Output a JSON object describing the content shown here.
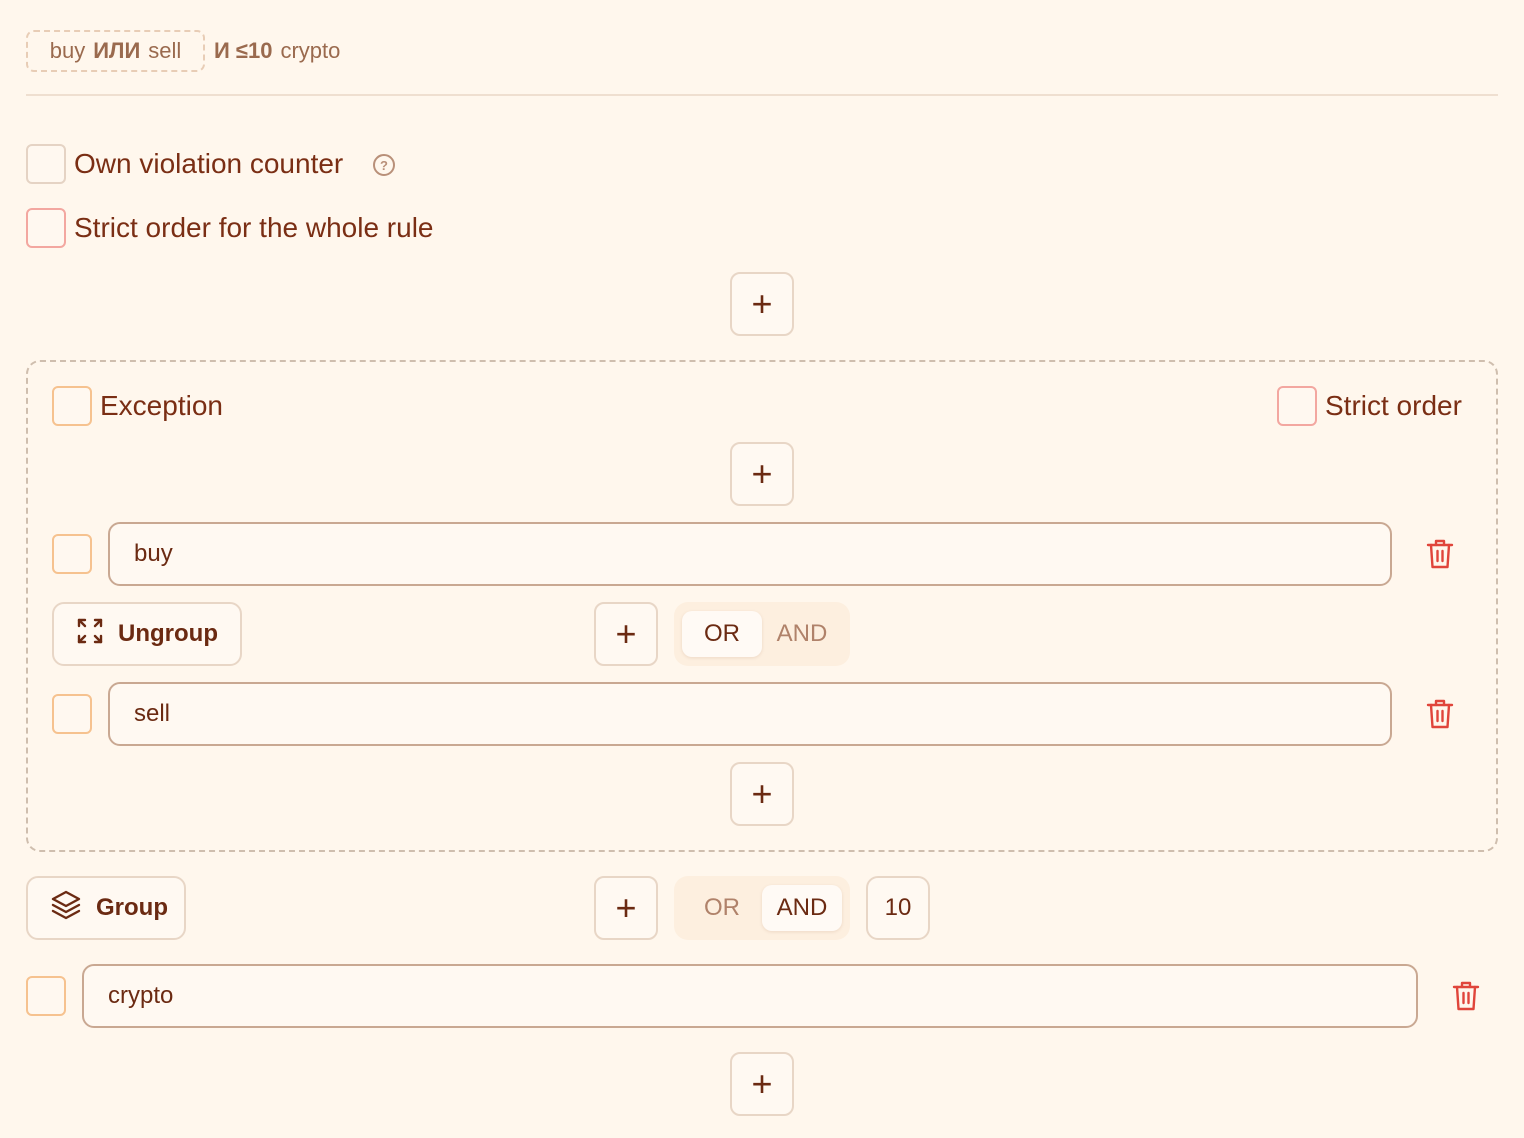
{
  "summary": {
    "chip": {
      "term1": "buy",
      "op": "ИЛИ",
      "term2": "sell"
    },
    "rest": {
      "op": "И ≤10",
      "term": "crypto"
    }
  },
  "options": {
    "own_violation_counter": "Own violation counter",
    "strict_order_rule": "Strict order for the whole rule"
  },
  "plus_symbol": "+",
  "exception_group": {
    "exception_label": "Exception",
    "strict_order_label": "Strict order",
    "terms": [
      "buy",
      "sell"
    ],
    "ungroup_label": "Ungroup",
    "toggle": {
      "or": "OR",
      "and": "AND",
      "active": "OR"
    }
  },
  "outer_group": {
    "group_label": "Group",
    "toggle": {
      "or": "OR",
      "and": "AND",
      "active": "AND"
    },
    "count": "10",
    "terms": [
      "crypto"
    ]
  },
  "colors": {
    "background": "#fff7ed",
    "text": "#7a2e14",
    "trash": "#e0453b"
  },
  "icons": {
    "help": "question-circle-icon",
    "plus": "plus-icon",
    "trash": "trash-icon",
    "ungroup": "expand-arrows-icon",
    "group": "layers-icon"
  }
}
